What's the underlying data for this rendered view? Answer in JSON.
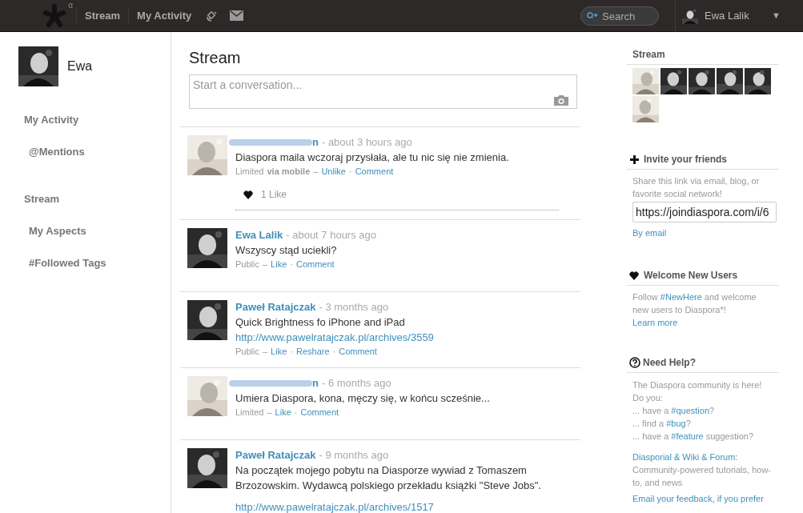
{
  "header": {
    "nav": [
      {
        "label": "Stream",
        "selected": false
      },
      {
        "label": "My Activity",
        "selected": false
      }
    ],
    "logo_mark": "α",
    "search": {
      "placeholder": "Search"
    },
    "user": {
      "name": "Ewa Lalik"
    },
    "menu_caret": "▼"
  },
  "sidebar": {
    "profile_name": "Ewa",
    "items": [
      {
        "label": "My Activity",
        "kind": "section"
      },
      {
        "label": "@Mentions",
        "kind": "sub"
      },
      {
        "label": "Stream",
        "kind": "section"
      },
      {
        "label": "My Aspects",
        "kind": "sub"
      },
      {
        "label": "#Followed Tags",
        "kind": "sub"
      }
    ]
  },
  "stream": {
    "title": "Stream",
    "composer": {
      "placeholder": "Start a conversation..."
    },
    "posts": [
      {
        "author": "n",
        "redacted": true,
        "time": "- about 3 hours ago",
        "text": "Diaspora maila wczoraj przysłała, ale tu nic się nie zmienia.",
        "meta": [
          {
            "kind": "text",
            "text": "Limited"
          },
          {
            "kind": "bold",
            "text": "via mobile"
          },
          {
            "kind": "text",
            "text": "–"
          },
          {
            "kind": "link",
            "text": "Unlike"
          },
          {
            "kind": "text",
            "text": "·"
          },
          {
            "kind": "link",
            "text": "Comment"
          }
        ],
        "likes": "1 Like"
      },
      {
        "author": "Ewa Lalik",
        "redacted": false,
        "time": "- about 7 hours ago",
        "text": "Wszyscy stąd uciekli?",
        "meta": [
          {
            "kind": "text",
            "text": "Public"
          },
          {
            "kind": "text",
            "text": "–"
          },
          {
            "kind": "link",
            "text": "Like"
          },
          {
            "kind": "text",
            "text": "·"
          },
          {
            "kind": "link",
            "text": "Comment"
          }
        ]
      },
      {
        "author": "Paweł Ratajczak",
        "redacted": false,
        "time": "- 3 months ago",
        "text": "Quick Brightness fo iPhone and iPad",
        "link": "http://www.pawelratajczak.pl/archives/3559",
        "gap": false,
        "meta": [
          {
            "kind": "text",
            "text": "Public"
          },
          {
            "kind": "text",
            "text": "–"
          },
          {
            "kind": "link",
            "text": "Like"
          },
          {
            "kind": "text",
            "text": "·"
          },
          {
            "kind": "link",
            "text": "Reshare"
          },
          {
            "kind": "text",
            "text": "·"
          },
          {
            "kind": "link",
            "text": "Comment"
          }
        ]
      },
      {
        "author": "n",
        "redacted": true,
        "time": "- 6 months ago",
        "text": "Umiera Diaspora, kona, męczy się, w końcu scześnie...",
        "meta": [
          {
            "kind": "text",
            "text": "Limited"
          },
          {
            "kind": "text",
            "text": "–"
          },
          {
            "kind": "link",
            "text": "Like"
          },
          {
            "kind": "text",
            "text": "·"
          },
          {
            "kind": "link",
            "text": "Comment"
          }
        ]
      },
      {
        "author": "Paweł Ratajczak",
        "redacted": false,
        "time": "- 9 months ago",
        "text": "Na początek mojego pobytu na Diasporze wywiad z Tomaszem Brzozowskim. Wydawcą polskiego przekładu książki \"Steve Jobs\".",
        "link": "http://www.pawelratajczak.pl/archives/1517",
        "gap": true
      }
    ]
  },
  "right": {
    "stream_title": "Stream",
    "invite": {
      "title": "Invite your friends",
      "text": "Share this link via email, blog, or favorite social network!",
      "url": "https://joindiaspora.com/i/6",
      "email_link": "By email"
    },
    "welcome": {
      "title": "Welcome New Users",
      "before": "Follow ",
      "tag": "#NewHere",
      "after": " and welcome new users to Diaspora*!",
      "link": "Learn more"
    },
    "help": {
      "title": "Need Help?",
      "intro": "The Diaspora community is here!",
      "lines": [
        {
          "text": "Do you:"
        },
        {
          "text": "... have a ",
          "tag": "#question",
          "after": "?"
        },
        {
          "text": "... find a ",
          "tag": "#bug",
          "after": "?"
        },
        {
          "text": "... have a ",
          "tag": "#feature",
          "after": " suggestion?"
        }
      ],
      "links": "Diasporial & Wiki & Forum:",
      "links_text": "Community-powered tutorials, how-to, and news",
      "feedback": "Email your feedback, if you prefer"
    }
  }
}
